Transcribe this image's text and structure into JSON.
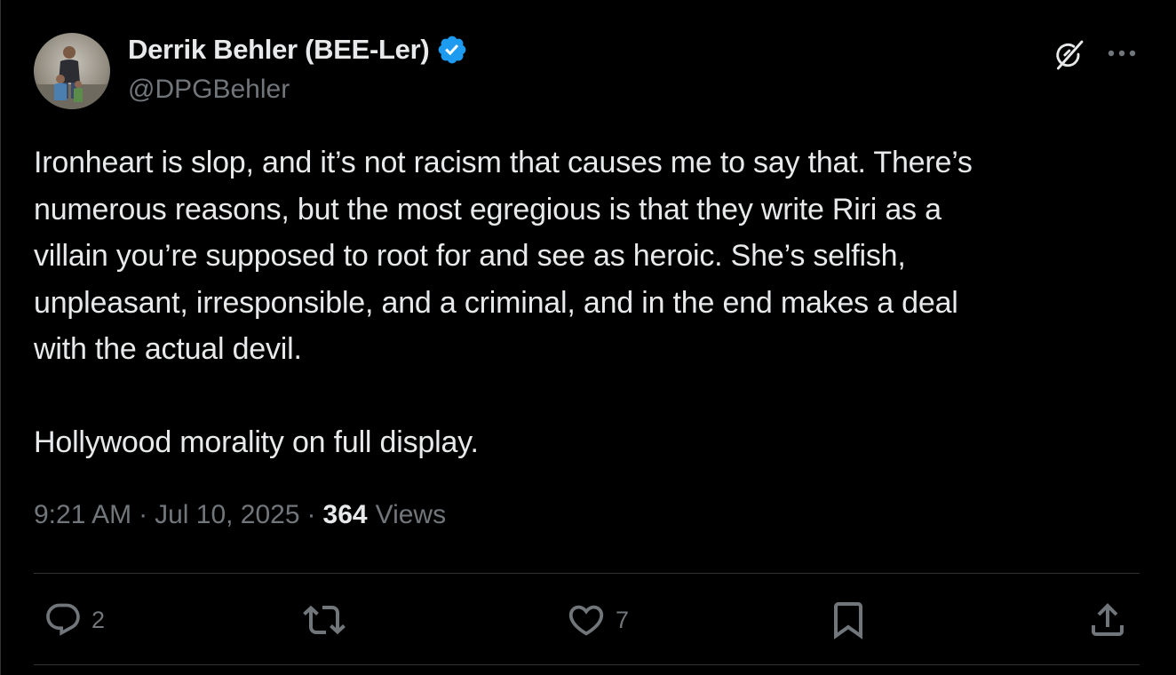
{
  "author": {
    "display_name": "Derrik Behler (BEE-Ler)",
    "handle": "@DPGBehler",
    "verified": true
  },
  "post": {
    "paragraphs": [
      [
        "Ironheart is slop, and it’s not racism that causes me to say that. There’s",
        "numerous reasons, but the most egregious is that they write Riri as a",
        "villain you’re supposed to root for and see as heroic. She’s selfish,",
        "unpleasant, irresponsible, and a criminal, and in the end makes a deal",
        "with the actual devil."
      ],
      [
        "Hollywood morality on full display."
      ]
    ]
  },
  "meta": {
    "time": "9:21 AM",
    "separator": "·",
    "date": "Jul 10, 2025",
    "views_count": "364",
    "views_label": "Views"
  },
  "actions": {
    "replies": "2",
    "reposts": "",
    "likes": "7"
  },
  "icons": {
    "verified": "verified-badge-icon",
    "grok": "grok-icon",
    "more": "more-icon",
    "reply": "reply-icon",
    "repost": "repost-icon",
    "like": "like-icon",
    "bookmark": "bookmark-icon",
    "share": "share-icon"
  },
  "colors": {
    "background": "#000000",
    "text_primary": "#e7e9ea",
    "text_secondary": "#71767b",
    "verified_blue": "#1d9bf0",
    "divider": "#2f3336"
  }
}
